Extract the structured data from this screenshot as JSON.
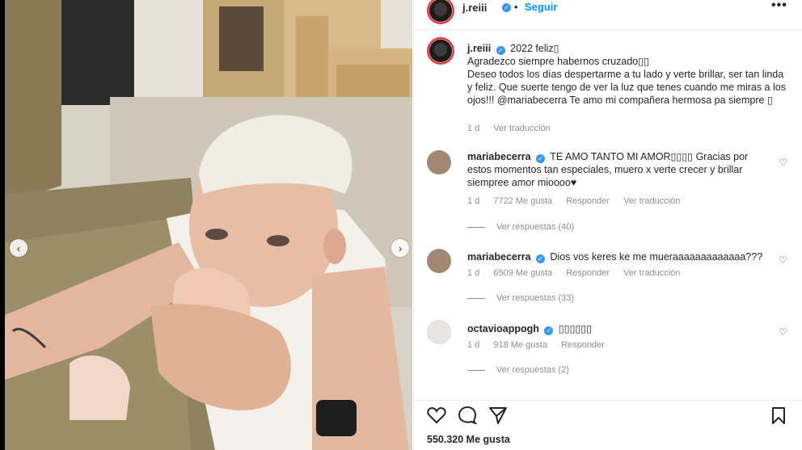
{
  "header": {
    "username": "j.reiii",
    "separator": "•",
    "follow_label": "Seguir",
    "more_icon": "more-options-icon"
  },
  "caption": {
    "username": "j.reiii",
    "text_line1": "2022 feliz▯",
    "text_line2": "Agradezco siempre habernos cruzado▯▯",
    "text_line3": "Deseo todos los días despertarme a tu lado y verte brillar, ser tan linda y feliz. Que suerte tengo de ver la luz que tenes cuando me miras a los ojos!!! @mariabecerra Te amo mi compañera hermosa pa siempre ▯",
    "time": "1 d",
    "translate": "Ver traducción"
  },
  "comments": [
    {
      "username": "mariabecerra",
      "text": "TE AMO TANTO MI AMOR▯▯▯▯ Gracias por estos momentos tan especiales, muero x verte crecer y brillar siempree amor mioooo♥",
      "time": "1 d",
      "likes": "7722 Me gusta",
      "reply": "Responder",
      "translate": "Ver traducción",
      "replies": "Ver respuestas (40)"
    },
    {
      "username": "mariabecerra",
      "text": "Dios vos keres ke me mueraaaaaaaaaaaaa???",
      "time": "1 d",
      "likes": "6509 Me gusta",
      "reply": "Responder",
      "translate": "Ver traducción",
      "replies": "Ver respuestas (33)"
    },
    {
      "username": "octavioappogh",
      "text": "▯▯▯▯▯▯",
      "time": "1 d",
      "likes": "918 Me gusta",
      "reply": "Responder",
      "replies": "Ver respuestas (2)"
    }
  ],
  "actions": {
    "like_icon": "heart-icon",
    "comment_icon": "comment-icon",
    "share_icon": "share-icon",
    "save_icon": "bookmark-icon"
  },
  "likes_total": "550.320 Me gusta",
  "carousel": {
    "prev": "‹",
    "next": "›"
  },
  "colors": {
    "accent": "#0095f6",
    "verified": "#3897f0",
    "muted": "#8e8e8e"
  }
}
